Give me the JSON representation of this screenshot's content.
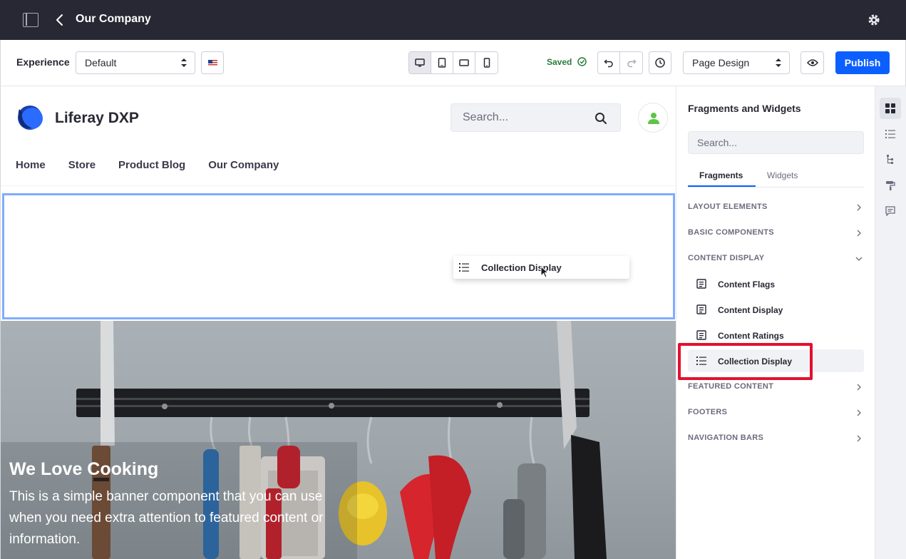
{
  "topbar": {
    "title": "Our Company",
    "back_icon": "chevron-left-icon",
    "panel_icon": "sidebar-toggle-icon",
    "settings_icon": "gear-icon"
  },
  "toolbar": {
    "experience_label": "Experience",
    "experience_value": "Default",
    "language_icon": "us-flag-icon",
    "devices": [
      "desktop-icon",
      "tablet-portrait-icon",
      "tablet-landscape-icon",
      "mobile-icon"
    ],
    "saved_label": "Saved",
    "mode_value": "Page Design",
    "publish_label": "Publish",
    "colors": {
      "primary": "#0b5fff",
      "success": "#287d3c",
      "header_bg": "#272833"
    }
  },
  "page": {
    "site_name": "Liferay DXP",
    "search_placeholder": "Search...",
    "nav": [
      "Home",
      "Store",
      "Product Blog",
      "Our Company"
    ],
    "drag_item": "Collection Display",
    "banner": {
      "title": "We Love Cooking",
      "text": "This is a simple banner component that you can use when you need extra attention to featured content or information."
    }
  },
  "panel": {
    "title": "Fragments and Widgets",
    "search_placeholder": "Search...",
    "tabs": [
      "Fragments",
      "Widgets"
    ],
    "categories": {
      "layout": "LAYOUT ELEMENTS",
      "basic": "BASIC COMPONENTS",
      "content": "CONTENT DISPLAY",
      "featured": "FEATURED CONTENT",
      "footers": "FOOTERS",
      "nav_bars": "NAVIGATION BARS"
    },
    "content_items": [
      "Content Flags",
      "Content Display",
      "Content Ratings",
      "Collection Display"
    ],
    "highlight_color": "#e3102f"
  },
  "rail": [
    "fragments-icon",
    "list-icon",
    "page-structure-icon",
    "paint-roller-icon",
    "comments-icon"
  ]
}
